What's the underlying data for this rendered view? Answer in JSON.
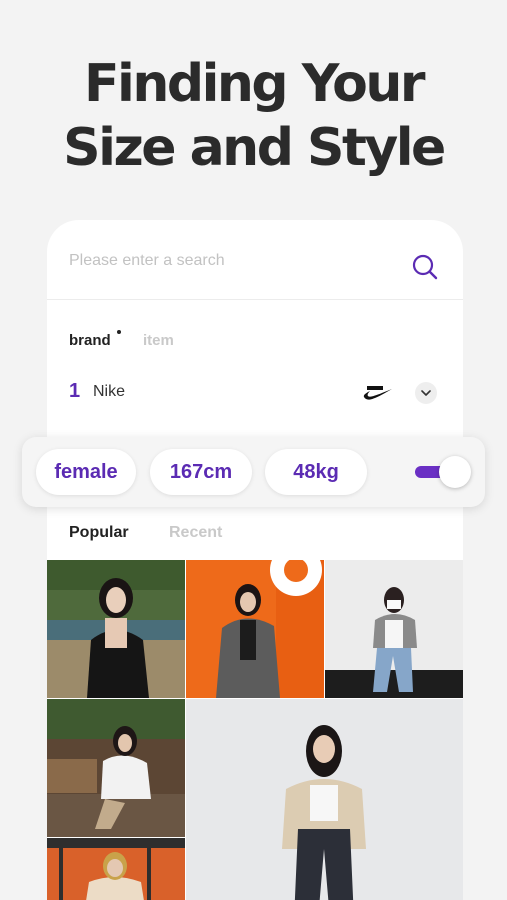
{
  "headline": {
    "line1": "Finding Your",
    "line2": "Size and Style"
  },
  "search": {
    "placeholder": "Please enter a search",
    "icon": "search-icon"
  },
  "segment_tabs": [
    {
      "label": "brand",
      "active": true
    },
    {
      "label": "item",
      "active": false
    }
  ],
  "ranking": {
    "rank": "1",
    "brand": "Nike",
    "logo": "nike-swoosh-logo"
  },
  "filters": [
    {
      "label": "female"
    },
    {
      "label": "167cm"
    },
    {
      "label": "48kg"
    }
  ],
  "filter_toggle": {
    "on": true
  },
  "sort_tabs": [
    {
      "label": "Popular",
      "active": true
    },
    {
      "label": "Recent",
      "active": false
    }
  ],
  "colors": {
    "accent": "#5b2bb3",
    "toggle": "#6a2fc4",
    "background": "#f3f3f3",
    "inactive_text": "#c9c9c9"
  }
}
